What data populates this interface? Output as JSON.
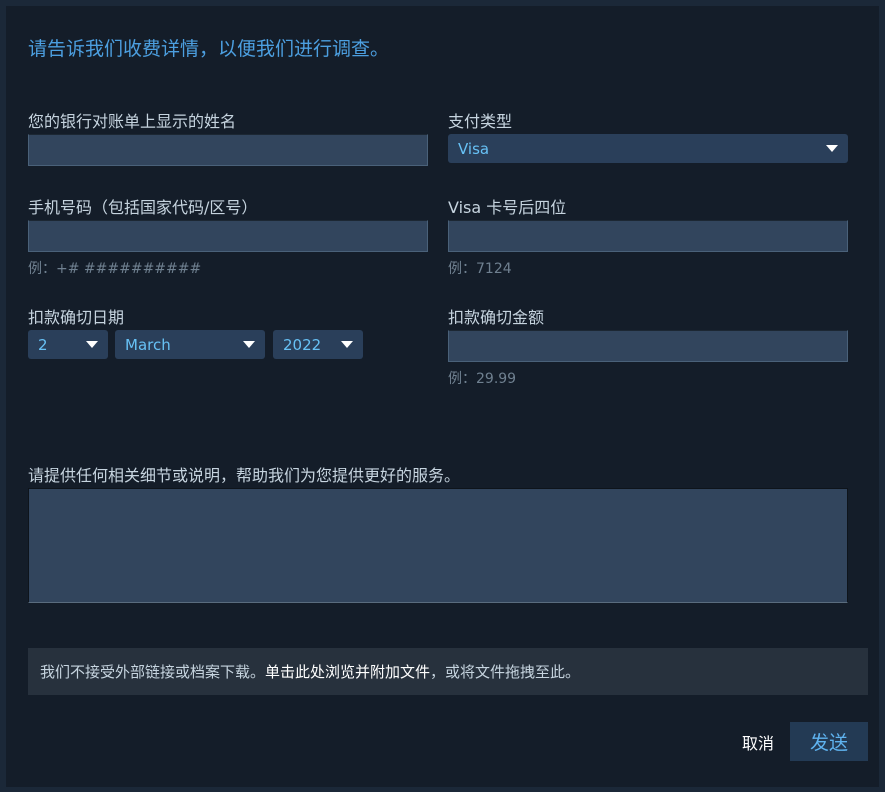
{
  "headline": "请告诉我们收费详情，以便我们进行调查。",
  "fields": {
    "bank_name": {
      "label": "您的银行对账单上显示的姓名",
      "value": ""
    },
    "payment_type": {
      "label": "支付类型",
      "selected": "Visa"
    },
    "phone": {
      "label": "手机号码（包括国家代码/区号）",
      "value": "",
      "hint": "例：+# ##########"
    },
    "card_last4": {
      "label": "Visa 卡号后四位",
      "value": "",
      "hint": "例：7124"
    },
    "charge_date": {
      "label": "扣款确切日期",
      "day": "2",
      "month": "March",
      "year": "2022"
    },
    "charge_amount": {
      "label": "扣款确切金额",
      "value": "",
      "hint": "例：29.99"
    },
    "details": {
      "label": "请提供任何相关细节或说明，帮助我们为您提供更好的服务。",
      "value": ""
    }
  },
  "attachment": {
    "prefix": "我们不接受外部链接或档案下载。",
    "link": "单击此处浏览并附加文件",
    "suffix": "，或将文件拖拽至此。"
  },
  "actions": {
    "cancel": "取消",
    "send": "发送"
  },
  "colors": {
    "accent": "#67c1f5",
    "background": "#141d29",
    "field": "#32455d"
  }
}
